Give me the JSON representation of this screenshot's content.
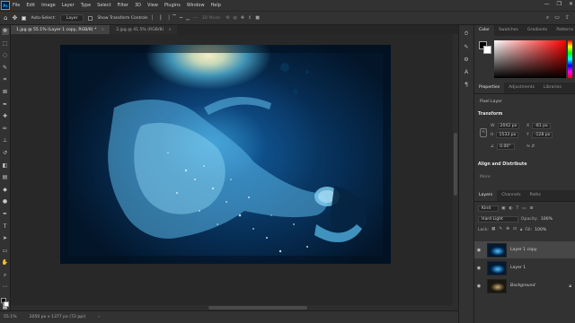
{
  "app": {
    "logo": "Ps"
  },
  "menu": [
    "File",
    "Edit",
    "Image",
    "Layer",
    "Type",
    "Select",
    "Filter",
    "3D",
    "View",
    "Plugins",
    "Window",
    "Help"
  ],
  "window_controls": [
    "—",
    "❐",
    "✕"
  ],
  "options": {
    "auto_select_label": "Auto-Select:",
    "auto_select_value": "Layer",
    "show_transform_label": "Show Transform Controls",
    "mode_3d": "3D Mode:",
    "dots": "···"
  },
  "doc_tabs": [
    {
      "label": "1.jpg @ 55.1% (Layer 1 copy, RGB/8) *",
      "close": "×"
    },
    {
      "label": "2.jpg @ 41.5% (RGB/8)",
      "close": "×"
    }
  ],
  "status": {
    "zoom": "55.1%",
    "doc_size": "2050 px x 1377 px (72 ppi)",
    "arrow": "›"
  },
  "panels": {
    "color_tabs": [
      "Color",
      "Swatches",
      "Gradients",
      "Patterns"
    ],
    "props_tabs": [
      "Properties",
      "Adjustments",
      "Libraries"
    ],
    "pixel_layer": "Pixel Layer",
    "transform_title": "Transform",
    "w_label": "W",
    "w_value": "2042 px",
    "h_label": "H",
    "h_value": "1533 px",
    "x_label": "X",
    "x_value": "-81 px",
    "y_label": "Y",
    "y_value": "-128 px",
    "angle_value": "0.00°",
    "align_title": "Align and Distribute",
    "more_label": "More:",
    "layers_tabs": [
      "Layers",
      "Channels",
      "Paths"
    ],
    "kind": "Kind",
    "blend_mode": "Hard Light",
    "opacity_label": "Opacity:",
    "opacity_value": "100%",
    "fill_label": "Fill:",
    "fill_value": "100%",
    "lock_label": "Lock:",
    "layers": [
      {
        "name": "Layer 1 copy",
        "selected": true
      },
      {
        "name": "Layer 1",
        "selected": false
      },
      {
        "name": "Background",
        "selected": false
      }
    ]
  },
  "colors": {
    "accent": "#31a8ff",
    "panel": "#323232",
    "selected_layer": "#474747"
  }
}
